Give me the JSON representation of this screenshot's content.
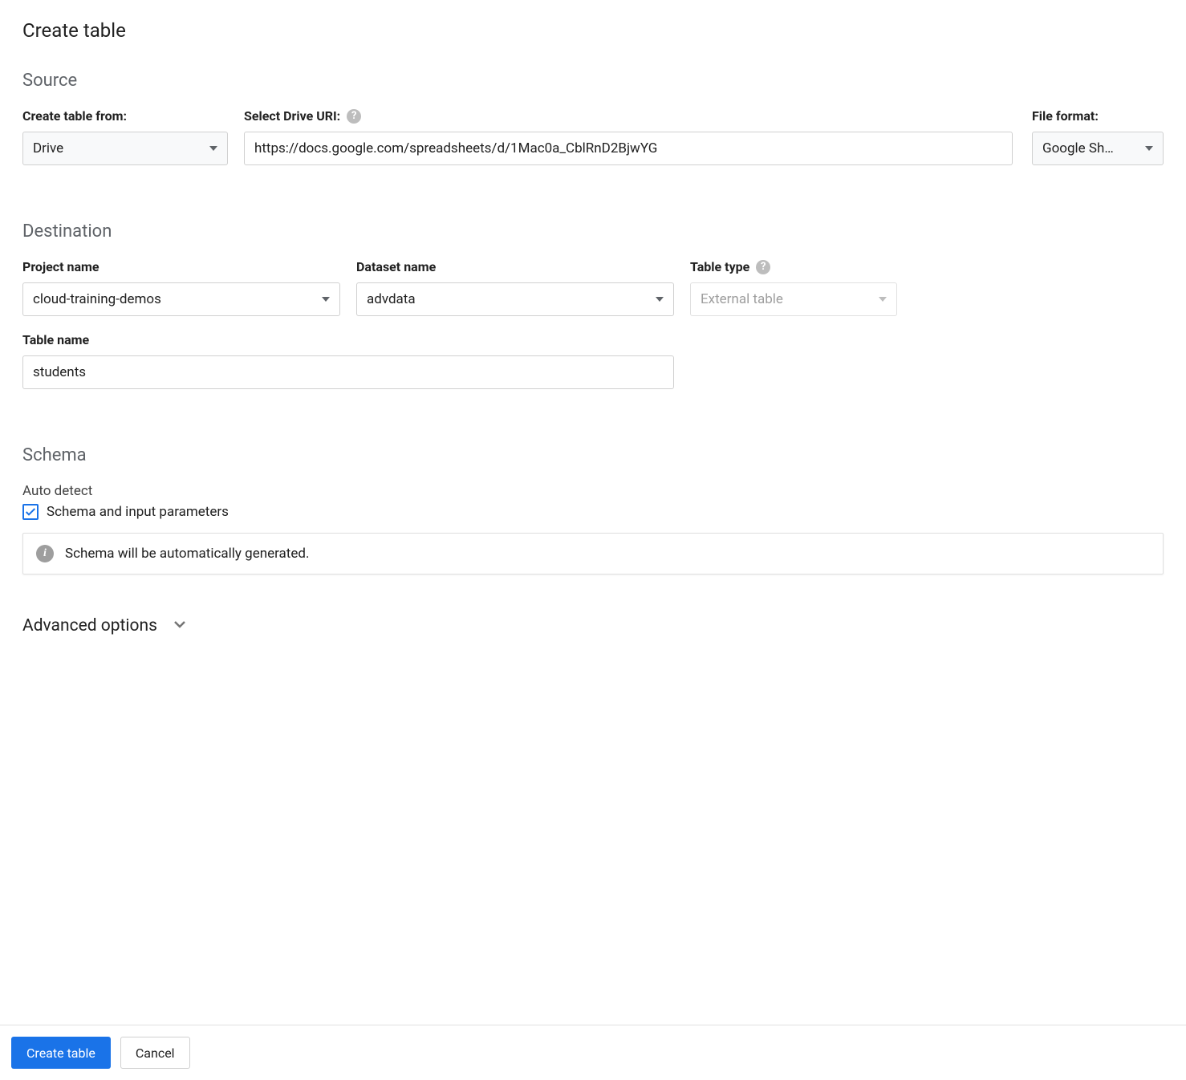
{
  "page_title": "Create table",
  "source": {
    "heading": "Source",
    "create_from_label": "Create table from:",
    "create_from_value": "Drive",
    "drive_uri_label": "Select Drive URI:",
    "drive_uri_value": "https://docs.google.com/spreadsheets/d/1Mac0a_CblRnD2BjwYG",
    "file_format_label": "File format:",
    "file_format_value": "Google Sh…"
  },
  "destination": {
    "heading": "Destination",
    "project_label": "Project name",
    "project_value": "cloud-training-demos",
    "dataset_label": "Dataset name",
    "dataset_value": "advdata",
    "table_type_label": "Table type",
    "table_type_value": "External table",
    "table_name_label": "Table name",
    "table_name_value": "students"
  },
  "schema": {
    "heading": "Schema",
    "auto_detect_label": "Auto detect",
    "checkbox_label": "Schema and input parameters",
    "info_text": "Schema will be automatically generated."
  },
  "advanced": {
    "label": "Advanced options"
  },
  "footer": {
    "create_label": "Create table",
    "cancel_label": "Cancel"
  }
}
